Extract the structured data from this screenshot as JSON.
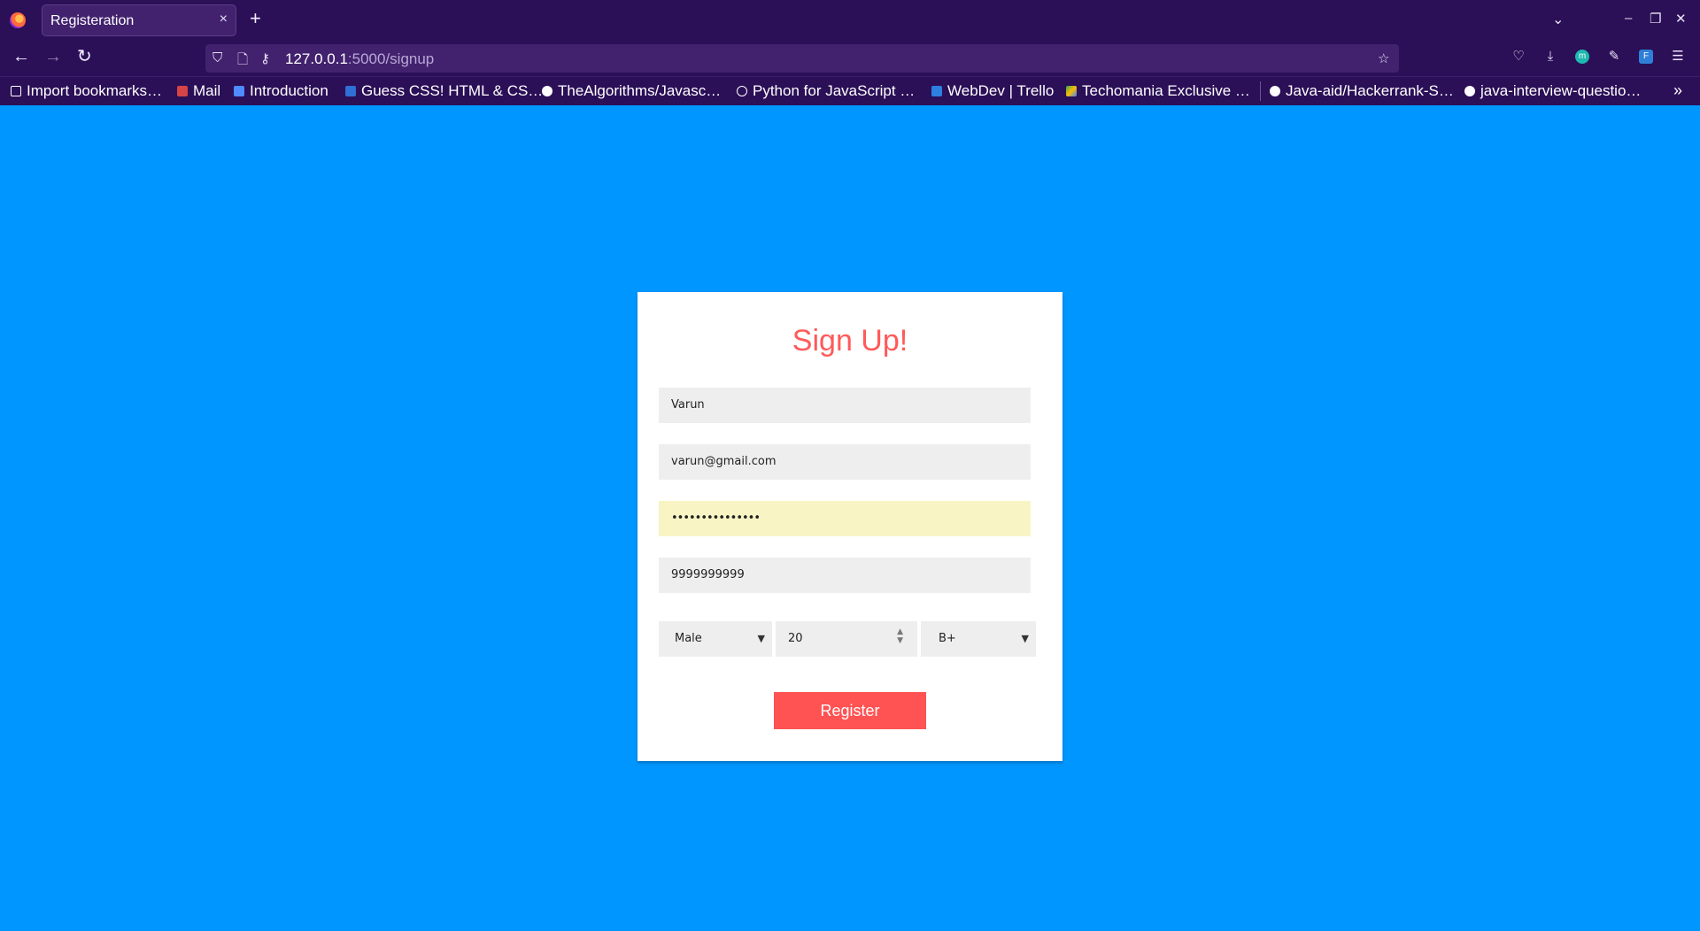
{
  "browser": {
    "tab_title": "Registeration",
    "tab_close": "×",
    "new_tab": "+",
    "url_host": "127.0.0.1",
    "url_path": ":5000/signup",
    "bookmarks": [
      "Import bookmarks…",
      "Mail",
      "Introduction",
      "Guess CSS! HTML & CS…",
      "TheAlgorithms/Javasc…",
      "Python for JavaScript …",
      "WebDev | Trello",
      "Techomania Exclusive …",
      "Java-aid/Hackerrank-S…",
      "java-interview-questio…"
    ]
  },
  "form": {
    "title": "Sign Up!",
    "name_value": "Varun",
    "email_value": "varun@gmail.com",
    "password_value": "•••••••••••••••",
    "phone_value": "9999999999",
    "gender_value": "Male",
    "age_value": "20",
    "blood_group_value": "B+",
    "register_label": "Register"
  },
  "colors": {
    "page_bg": "#0096ff",
    "accent": "#ff5252",
    "chrome": "#2b0f57"
  }
}
